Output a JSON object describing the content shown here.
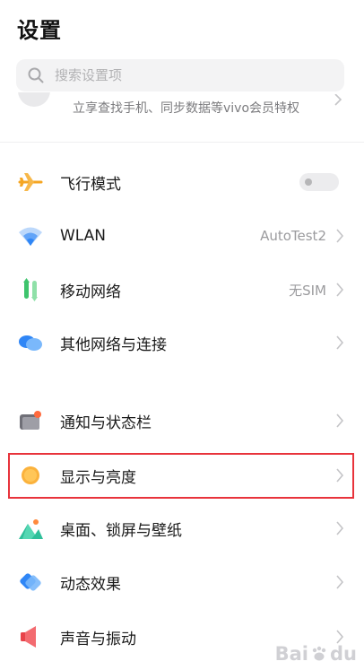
{
  "header": {
    "title": "设置"
  },
  "search": {
    "placeholder": "搜索设置项"
  },
  "account": {
    "subtitle": "立享查找手机、同步数据等vivo会员特权"
  },
  "rows": [
    {
      "label": "飞行模式",
      "value": "",
      "control": "toggle",
      "toggle_on": false
    },
    {
      "label": "WLAN",
      "value": "AutoTest2",
      "control": "chevron"
    },
    {
      "label": "移动网络",
      "value": "无SIM",
      "control": "chevron"
    },
    {
      "label": "其他网络与连接",
      "value": "",
      "control": "chevron"
    },
    {
      "label": "通知与状态栏",
      "value": "",
      "control": "chevron"
    },
    {
      "label": "显示与亮度",
      "value": "",
      "control": "chevron",
      "highlighted": true
    },
    {
      "label": "桌面、锁屏与壁纸",
      "value": "",
      "control": "chevron"
    },
    {
      "label": "动态效果",
      "value": "",
      "control": "chevron"
    },
    {
      "label": "声音与振动",
      "value": "",
      "control": "chevron"
    }
  ],
  "icons": {
    "airplane": "airplane-icon",
    "wlan": "wifi-icon",
    "mobile": "mobile-network-icon",
    "other_network": "cloud-network-icon",
    "notification": "notification-bar-icon",
    "display": "sun-brightness-icon",
    "desktop": "wallpaper-icon",
    "effects": "dynamic-effect-icon",
    "sound": "speaker-icon"
  },
  "colors": {
    "highlight_border": "#e8333b",
    "airplane": "#f5a623",
    "wlan": "#2f86f6",
    "mobile": "#3ec46d",
    "display": "#fbb23c"
  },
  "watermark": {
    "text_left": "Bai",
    "text_right": "du"
  }
}
